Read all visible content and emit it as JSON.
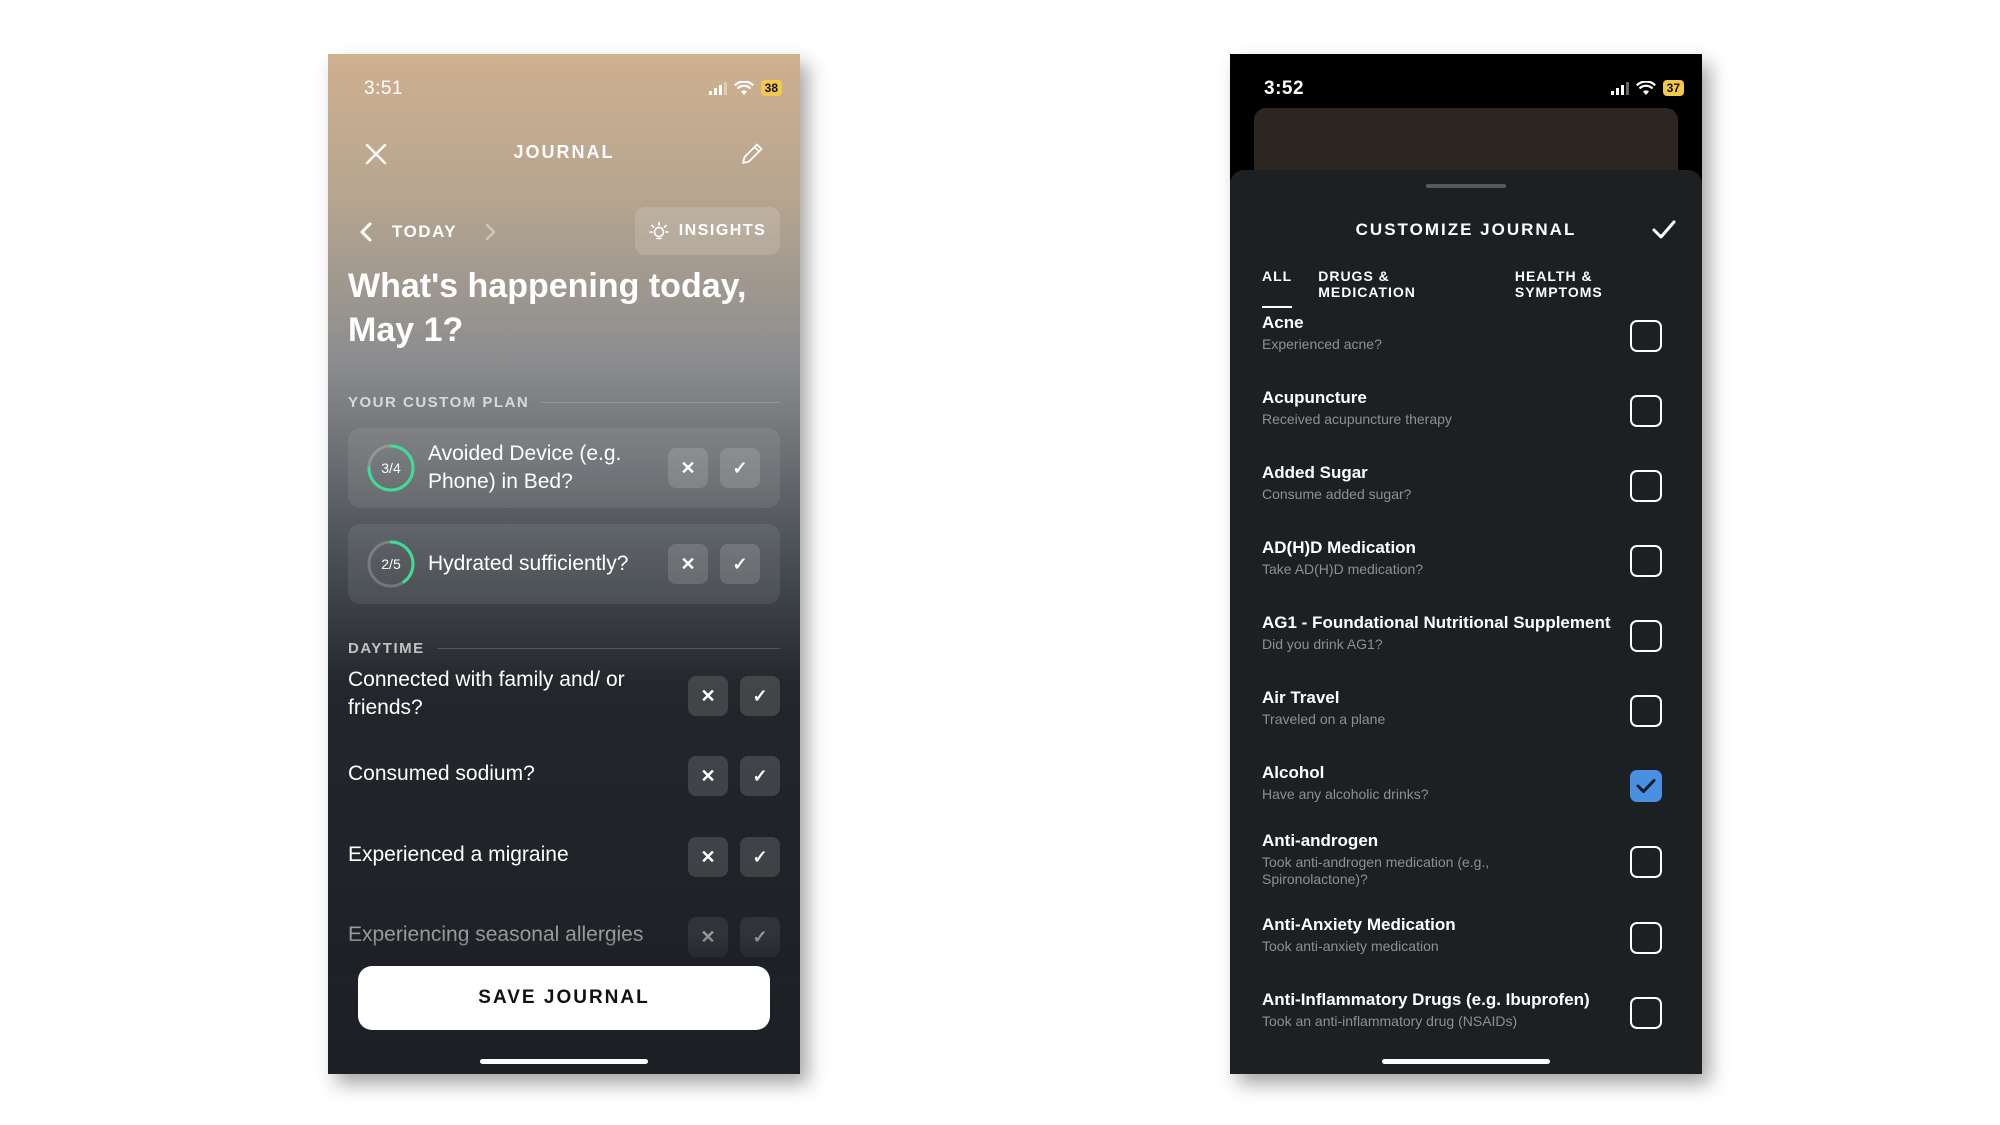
{
  "left_phone": {
    "status": {
      "time": "3:51",
      "battery": "38"
    },
    "header": {
      "title": "JOURNAL"
    },
    "nav": {
      "day_label": "TODAY",
      "insights_label": "INSIGHTS"
    },
    "headline": "What's happening today, May 1?",
    "plan_section": "YOUR CUSTOM PLAN",
    "plan_items": [
      {
        "progress_text": "3/4",
        "progress": 0.75,
        "label": "Avoided Device (e.g. Phone) in Bed?"
      },
      {
        "progress_text": "2/5",
        "progress": 0.4,
        "label": "Hydrated sufficiently?"
      }
    ],
    "daytime_section": "DAYTIME",
    "daytime_items": [
      {
        "label": "Connected with family and/ or friends?"
      },
      {
        "label": "Consumed sodium?"
      },
      {
        "label": "Experienced a migraine"
      },
      {
        "label": "Experiencing seasonal allergies"
      }
    ],
    "save_label": "SAVE JOURNAL"
  },
  "right_phone": {
    "status": {
      "time": "3:52",
      "battery": "37"
    },
    "sheet_title": "CUSTOMIZE JOURNAL",
    "tabs": [
      {
        "label": "ALL",
        "active": true
      },
      {
        "label": "DRUGS & MEDICATION",
        "active": false
      },
      {
        "label": "HEALTH & SYMPTOMS",
        "active": false
      }
    ],
    "items": [
      {
        "name": "Acne",
        "desc": "Experienced acne?",
        "checked": false
      },
      {
        "name": "Acupuncture",
        "desc": "Received acupuncture therapy",
        "checked": false
      },
      {
        "name": "Added Sugar",
        "desc": "Consume added sugar?",
        "checked": false
      },
      {
        "name": "AD(H)D Medication",
        "desc": "Take AD(H)D medication?",
        "checked": false
      },
      {
        "name": "AG1 - Foundational Nutritional Supplement",
        "desc": "Did you drink AG1?",
        "checked": false
      },
      {
        "name": "Air Travel",
        "desc": "Traveled on a plane",
        "checked": false
      },
      {
        "name": "Alcohol",
        "desc": "Have any alcoholic drinks?",
        "checked": true
      },
      {
        "name": "Anti-androgen",
        "desc": "Took anti-androgen medication (e.g., Spironolactone)?",
        "checked": false
      },
      {
        "name": "Anti-Anxiety Medication",
        "desc": "Took anti-anxiety medication",
        "checked": false
      },
      {
        "name": "Anti-Inflammatory Drugs (e.g. Ibuprofen)",
        "desc": "Took an anti-inflammatory drug (NSAIDs)",
        "checked": false
      }
    ]
  },
  "colors": {
    "accent_green": "#3ddc97",
    "checkbox_blue": "#4a90e2"
  }
}
